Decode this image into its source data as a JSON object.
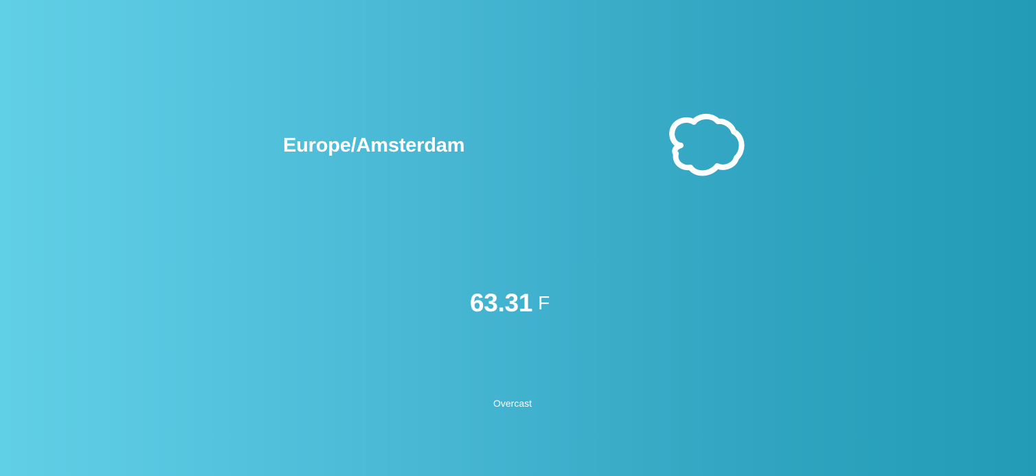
{
  "weather": {
    "location": "Europe/Amsterdam",
    "icon": "cloud-icon",
    "temperature": "63.31",
    "unit": "F",
    "description": "Overcast"
  },
  "colors": {
    "background_start": "#61d0e6",
    "background_end": "#229bb6",
    "text": "#ffffff"
  }
}
